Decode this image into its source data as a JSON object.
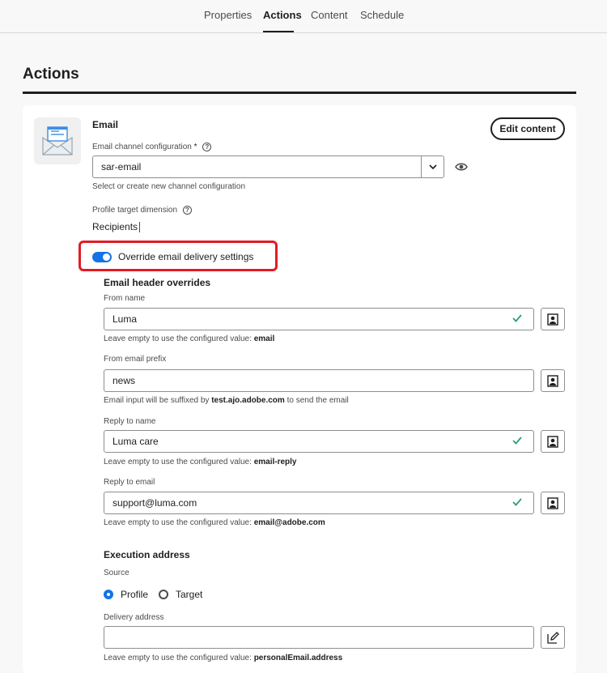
{
  "tabs": [
    {
      "label": "Properties"
    },
    {
      "label": "Actions"
    },
    {
      "label": "Content"
    },
    {
      "label": "Schedule"
    }
  ],
  "page_title": "Actions",
  "email": {
    "heading": "Email",
    "edit_button": "Edit content",
    "channel_config_label": "Email channel configuration",
    "required_mark": "*",
    "channel_config_value": "sar-email",
    "channel_config_help": "Select or create new channel configuration",
    "profile_target_label": "Profile target dimension",
    "profile_target_value": "Recipients",
    "override_toggle_label": "Override email delivery settings",
    "override_enabled": true
  },
  "header_overrides": {
    "heading": "Email header overrides",
    "fields": [
      {
        "label": "From name",
        "value": "Luma",
        "help_prefix": "Leave empty to use the configured value: ",
        "help_bold": "email",
        "help_suffix": "",
        "valid": true
      },
      {
        "label": "From email prefix",
        "value": "news",
        "help_prefix": "Email input will be suffixed by ",
        "help_bold": "test.ajo.adobe.com",
        "help_suffix": " to send the email",
        "valid": false
      },
      {
        "label": "Reply to name",
        "value": "Luma care",
        "help_prefix": "Leave empty to use the configured value: ",
        "help_bold": "email-reply",
        "help_suffix": "",
        "valid": true
      },
      {
        "label": "Reply to email",
        "value": "support@luma.com",
        "help_prefix": "Leave empty to use the configured value: ",
        "help_bold": "email@adobe.com",
        "help_suffix": "",
        "valid": true
      }
    ]
  },
  "execution": {
    "heading": "Execution address",
    "source_label": "Source",
    "options": [
      {
        "label": "Profile",
        "selected": true
      },
      {
        "label": "Target",
        "selected": false
      }
    ],
    "delivery_label": "Delivery address",
    "delivery_value": "",
    "delivery_help_prefix": "Leave empty to use the configured value: ",
    "delivery_help_bold": "personalEmail.address"
  },
  "colors": {
    "accent": "#1473e6",
    "highlight": "#e31b23",
    "valid": "#2d9d78"
  }
}
